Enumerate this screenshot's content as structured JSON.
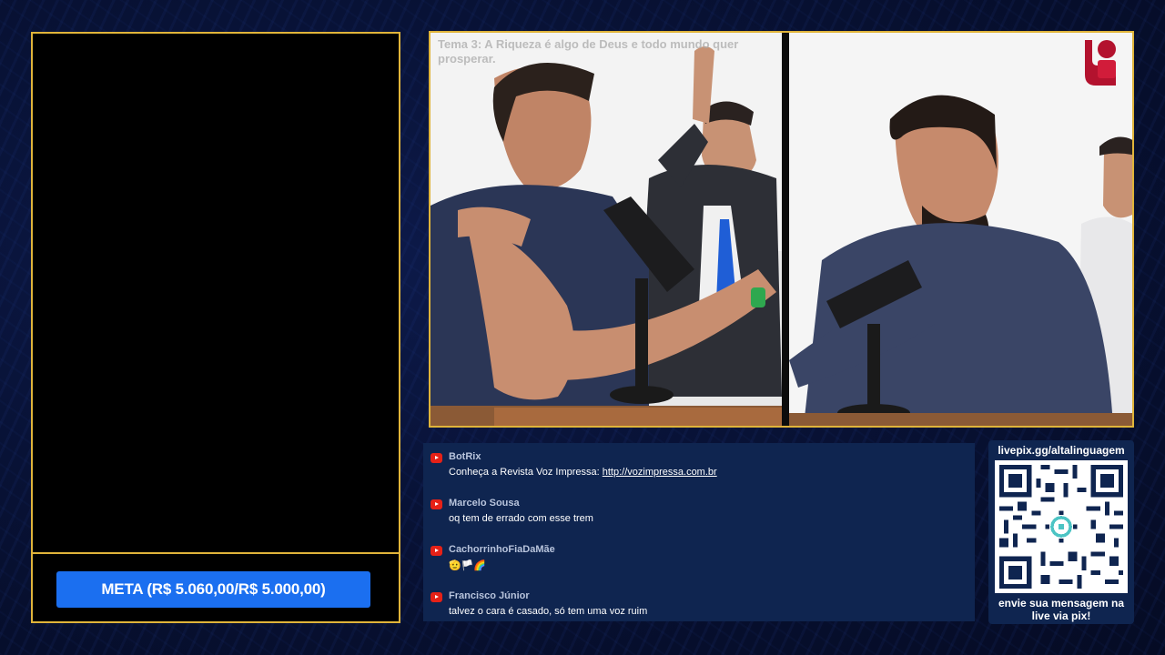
{
  "meta": {
    "label": "META (R$ 5.060,00/R$ 5.000,00)"
  },
  "video": {
    "topic": "Tema 3: A Riqueza é algo de Deus e todo mundo quer prosperar.",
    "logo_icon": "speaker-logo-icon"
  },
  "chat": {
    "messages": [
      {
        "author": "BotRix",
        "text_prefix": "Conheça a Revista Voz Impressa: ",
        "link": "http://vozimpressa.com.br"
      },
      {
        "author": "Marcelo Sousa",
        "text": "oq tem de errado com esse trem"
      },
      {
        "author": "CachorrinhoFiaDaMãe",
        "text": "🫡🏳️🌈"
      },
      {
        "author": "Francisco Júnior",
        "text": "talvez o cara é casado, só tem uma voz ruim"
      }
    ]
  },
  "pix": {
    "url": "livepix.gg/altalinguagem",
    "cta": "envie sua mensagem na live via pix!"
  },
  "colors": {
    "border_gold": "#e0b43a",
    "meta_blue": "#1b6ff0",
    "chat_bg": "#0f2550",
    "youtube_red": "#e62117"
  }
}
